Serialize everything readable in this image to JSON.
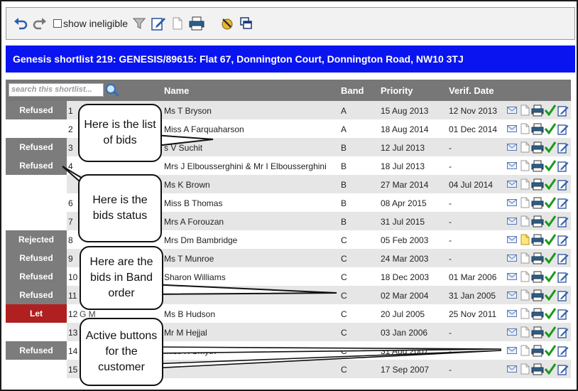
{
  "toolbar": {
    "show_ineligible_label": "show ineligible",
    "icons": [
      "undo-icon",
      "redo-icon",
      "filter-icon",
      "edit-icon",
      "document-icon",
      "print-icon",
      "tools-icon",
      "windows-icon"
    ]
  },
  "title": "Genesis shortlist 219: GENESIS/89615: Flat 67, Donnington Court, Donnington Road, NW10 3TJ",
  "search": {
    "placeholder": "search this shortlist..."
  },
  "columns": {
    "name": "Name",
    "band": "Band",
    "priority": "Priority",
    "verif_date": "Verif. Date"
  },
  "rows": [
    {
      "status": "Refused",
      "num": "1",
      "addr": "",
      "name": "Ms T Bryson",
      "band": "A",
      "priority": "15 Aug 2013",
      "verif": "12 Nov 2013"
    },
    {
      "status": "",
      "num": "2",
      "addr": "",
      "name": "Miss A Farquaharson",
      "band": "A",
      "priority": "18 Aug 2014",
      "verif": "01 Dec 2014"
    },
    {
      "status": "Refused",
      "num": "3",
      "addr": "",
      "name": "s V Suchit",
      "band": "B",
      "priority": "12 Jul 2013",
      "verif": "-"
    },
    {
      "status": "Refused",
      "num": "4",
      "addr": "",
      "name": "Mrs J Elbousserghini & Mr I Elbousserghini",
      "band": "B",
      "priority": "18 Jul 2013",
      "verif": "-"
    },
    {
      "status": "",
      "num": "",
      "addr": "",
      "name": "Ms K Brown",
      "band": "B",
      "priority": "27 Mar 2014",
      "verif": "04 Jul 2014"
    },
    {
      "status": "",
      "num": "6",
      "addr": "",
      "name": "Miss B Thomas",
      "band": "B",
      "priority": "08 Apr 2015",
      "verif": "-"
    },
    {
      "status": "",
      "num": "7",
      "addr": "",
      "name": "Mrs A Forouzan",
      "band": "B",
      "priority": "31 Jul 2015",
      "verif": "-"
    },
    {
      "status": "Rejected",
      "num": "8",
      "addr": "",
      "name": "Mrs Dm Bambridge",
      "band": "C",
      "priority": "05 Feb 2003",
      "verif": "-"
    },
    {
      "status": "Refused",
      "num": "9",
      "addr": "",
      "name": "Ms T Munroe",
      "band": "C",
      "priority": "24 Mar 2003",
      "verif": "-"
    },
    {
      "status": "Refused",
      "num": "10",
      "addr": "",
      "name": "Sharon Williams",
      "band": "C",
      "priority": "18 Dec 2003",
      "verif": "01 Mar 2006"
    },
    {
      "status": "Refused",
      "num": "11",
      "addr": "",
      "name": "",
      "band": "C",
      "priority": "02 Mar 2004",
      "verif": "31 Jan 2005"
    },
    {
      "status": "Let",
      "num": "12",
      "addr": "G  M",
      "name": "Ms B Hudson",
      "band": "C",
      "priority": "20 Jul 2005",
      "verif": "25 Nov 2011"
    },
    {
      "status": "",
      "num": "13",
      "addr": "",
      "name": "Mr M Hejjal",
      "band": "C",
      "priority": "03 Jan 2006",
      "verif": "-"
    },
    {
      "status": "Refused",
      "num": "14",
      "addr": "",
      "name": "Miss K Smyth",
      "band": "C",
      "priority": "31 Aug 2007",
      "verif": "-"
    },
    {
      "status": "",
      "num": "15",
      "addr": "",
      "name": "",
      "band": "C",
      "priority": "17 Sep 2007",
      "verif": "-"
    }
  ],
  "callouts": {
    "bids_list": "Here is the list of bids",
    "bids_status": "Here is the bids status",
    "band_order": "Here are the bids in Band order",
    "active_buttons": "Active buttons for the customer"
  },
  "colors": {
    "title_bar": "#0a14f0",
    "header": "#777777",
    "status_grey": "#7c7c7c",
    "status_let": "#b02020",
    "tick_green": "#1a9a1a"
  }
}
